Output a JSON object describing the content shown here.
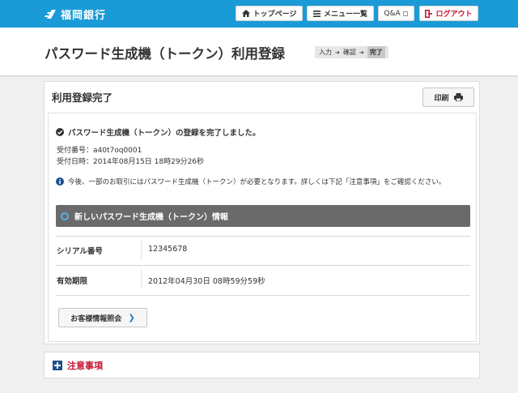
{
  "header": {
    "bank_name": "福岡銀行",
    "top_page": "トップページ",
    "menu": "メニュー一覧",
    "qa": "Q&A",
    "logout": "ログアウト"
  },
  "page": {
    "title": "パスワード生成機（トークン）利用登録",
    "steps": [
      "入力",
      "確認",
      "完了"
    ],
    "current_step": "完了"
  },
  "section": {
    "title": "利用登録完了",
    "print_label": "印刷"
  },
  "result": {
    "message": "パスワード生成機（トークン）の登録を完了しました。",
    "receipt_number": "受付番号：a40t7oq0001",
    "receipt_datetime": "受付日時：2014年08月15日 18時29分26秒",
    "notice": "今後、一部のお取引にはパスワード生成機（トークン）が必要となります。詳しくは下記「注意事項」をご確認ください。"
  },
  "token": {
    "heading": "新しいパスワード生成機（トークン）情報",
    "rows": [
      {
        "label": "シリアル番号",
        "value": "12345678"
      },
      {
        "label": "有効期限",
        "value": "2012年04月30日 08時59分59秒"
      }
    ]
  },
  "customer_button": "お客様情報照会",
  "caution": {
    "label": "注意事項"
  },
  "colors": {
    "header_blue": "#1a9ad6",
    "accent_red": "#c8102e",
    "bar_gray": "#6a6a6a"
  }
}
